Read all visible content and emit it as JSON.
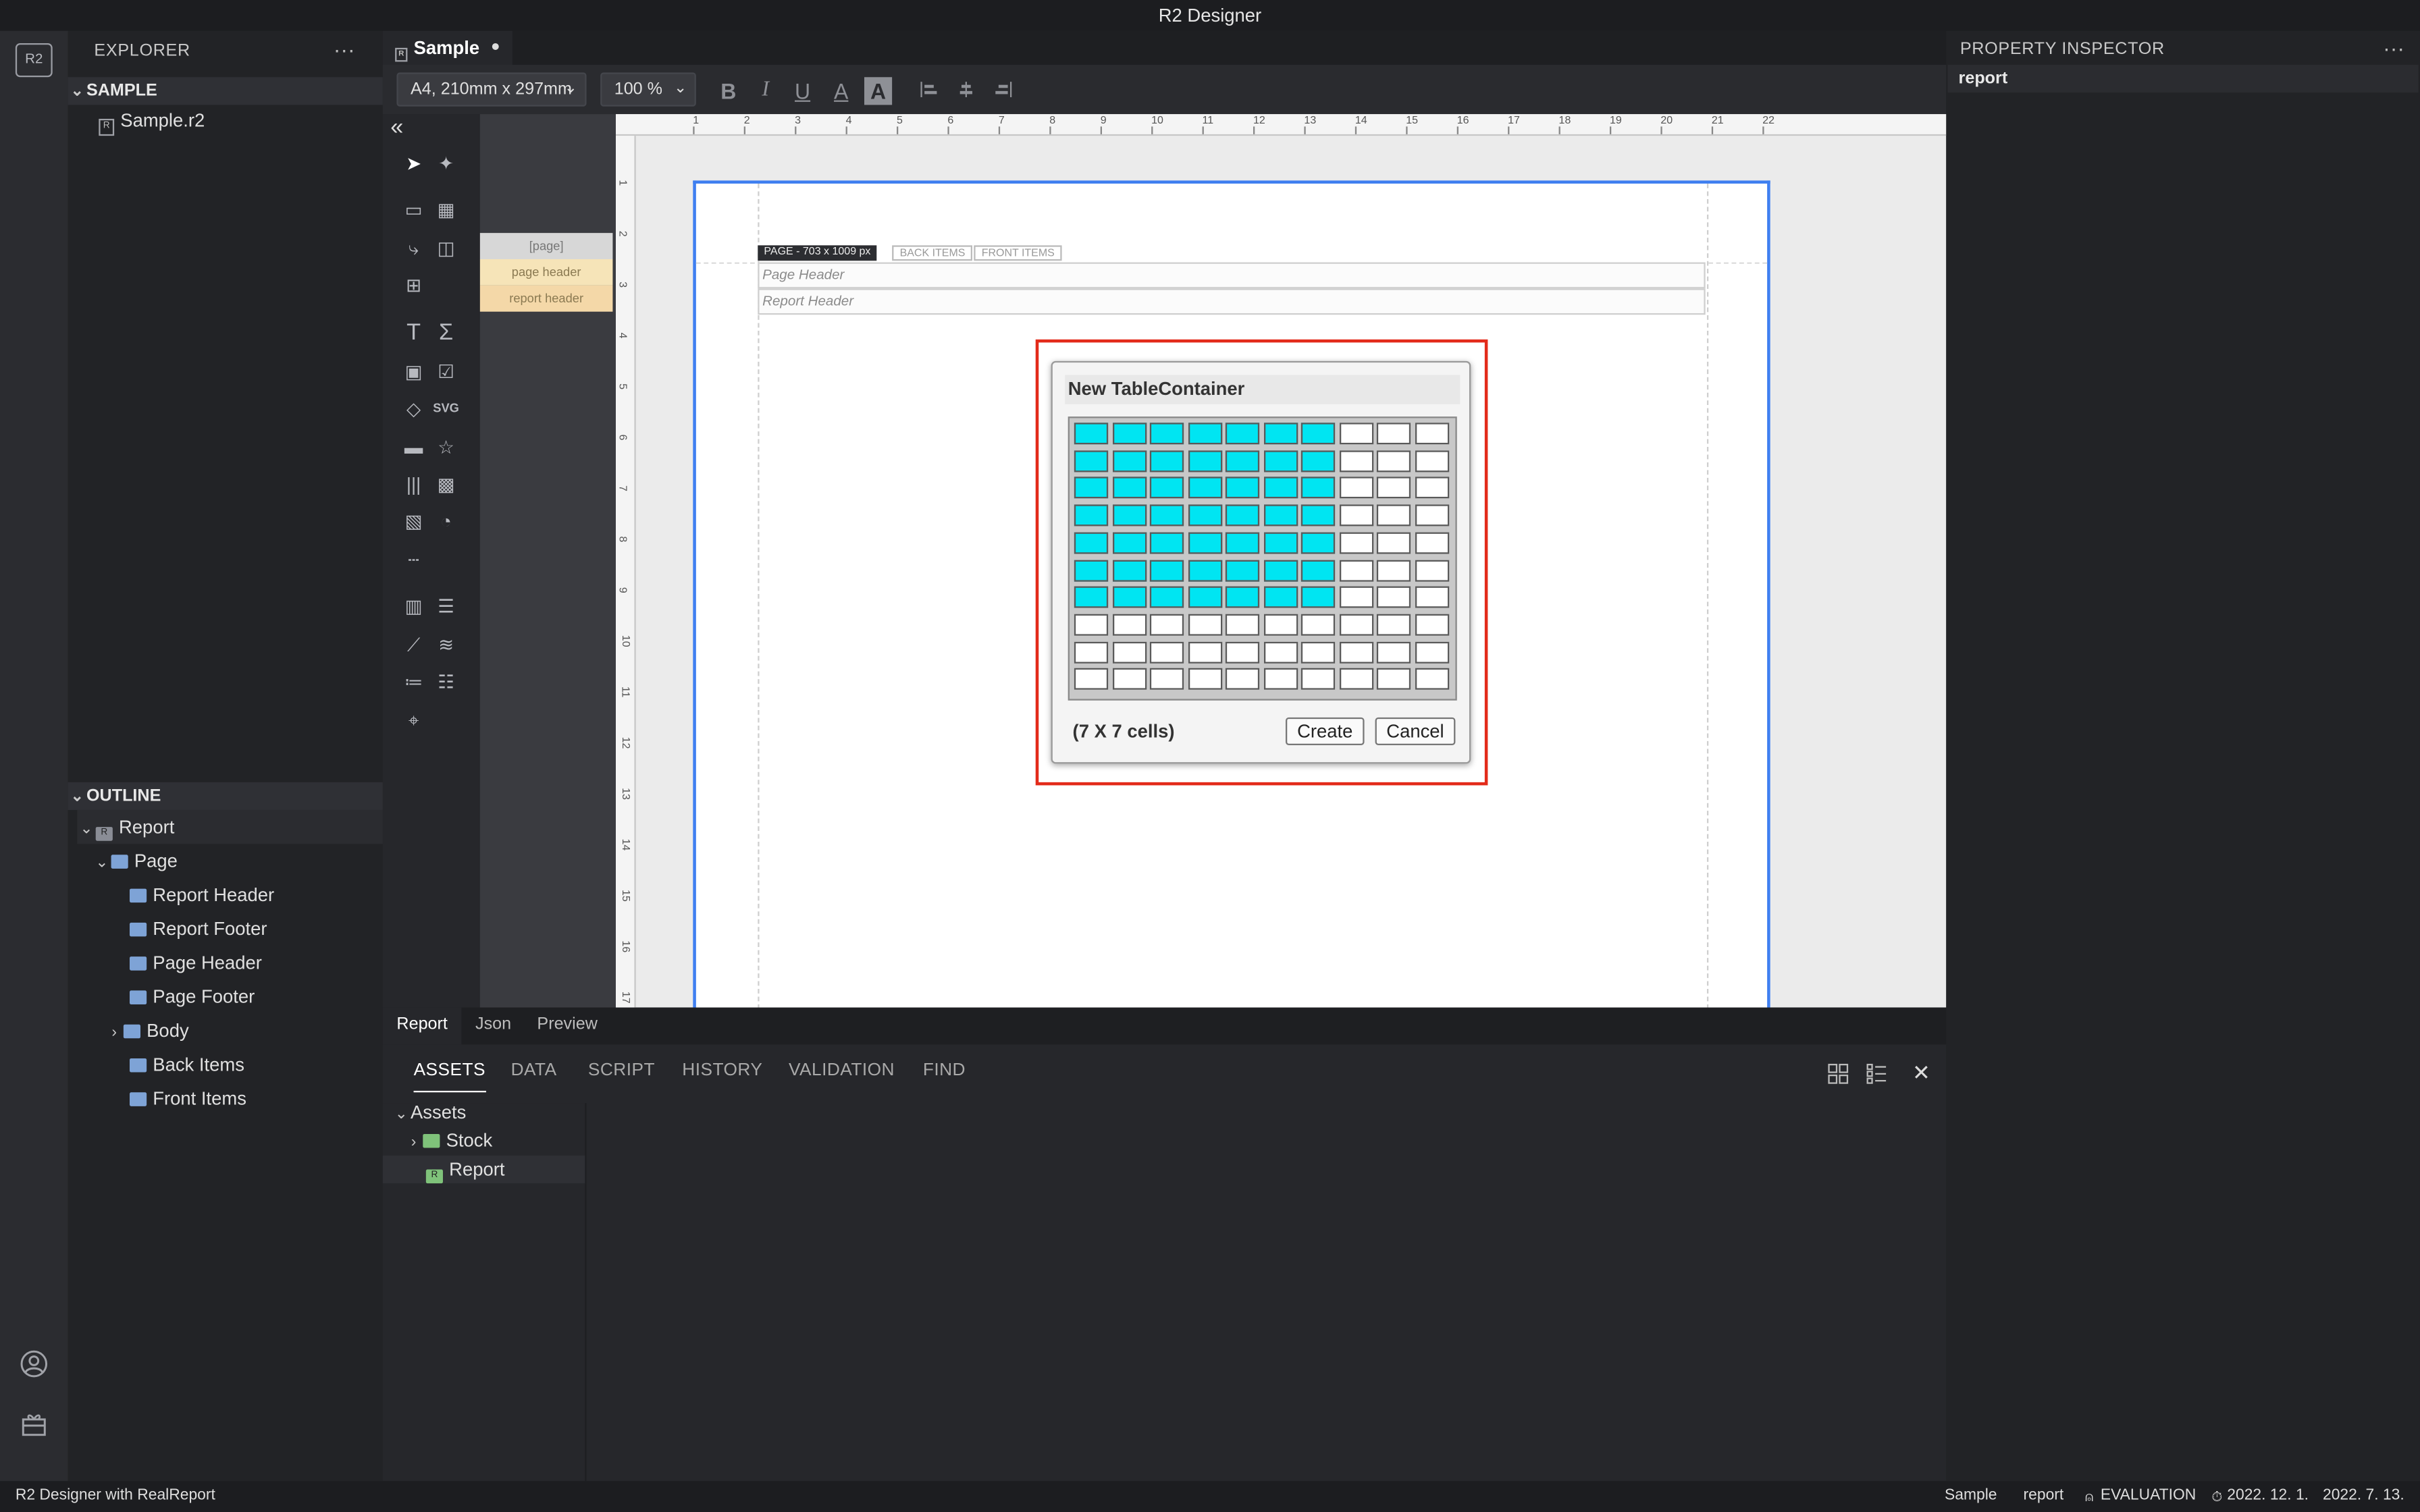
{
  "app": {
    "title": "R2 Designer",
    "logo": "R2"
  },
  "explorer": {
    "title": "EXPLORER",
    "more": "···",
    "section": "SAMPLE",
    "file": "Sample.r2"
  },
  "outline": {
    "title": "OUTLINE",
    "report": "Report",
    "page": "Page",
    "items": [
      "Report Header",
      "Report Footer",
      "Page Header",
      "Page Footer",
      "Body",
      "Back Items",
      "Front Items"
    ]
  },
  "editor": {
    "tab": "Sample",
    "paper": "A4, 210mm x 297mm",
    "zoom": "100 %",
    "format_buttons": [
      "B",
      "I",
      "U",
      "A",
      "A"
    ],
    "ruler_h": [
      "1",
      "2",
      "3",
      "4",
      "5",
      "6",
      "7",
      "8",
      "9",
      "10",
      "11",
      "12",
      "13",
      "14",
      "15",
      "16",
      "17",
      "18",
      "19",
      "20",
      "21",
      "22"
    ],
    "ruler_v": [
      "1",
      "2",
      "3",
      "4",
      "5",
      "6",
      "7",
      "8",
      "9",
      "10",
      "11",
      "12",
      "13",
      "14",
      "15",
      "16",
      "17"
    ],
    "bands": [
      "[page]",
      "page header",
      "report header"
    ],
    "page_badges": [
      "PAGE - 703 x 1009 px",
      "BACK ITEMS",
      "FRONT ITEMS"
    ],
    "page_header": "Page Header",
    "report_header": "Report Header",
    "tools": {
      "svg_label": "SVG"
    }
  },
  "dialog": {
    "title": "New TableContainer",
    "grid": {
      "rows": 10,
      "cols": 10,
      "selected_rows": 7,
      "selected_cols": 7
    },
    "info": "(7 X 7 cells)",
    "create": "Create",
    "cancel": "Cancel"
  },
  "view_tabs": [
    "Report",
    "Json",
    "Preview"
  ],
  "bottom_panel": {
    "tabs": [
      "ASSETS",
      "DATA",
      "SCRIPT",
      "HISTORY",
      "VALIDATION",
      "FIND"
    ],
    "assets_root": "Assets",
    "stock": "Stock",
    "report": "Report",
    "close": "✕"
  },
  "inspector": {
    "title": "PROPERTY INSPECTOR",
    "more": "···",
    "selected": "report"
  },
  "status": {
    "left": "R2 Designer with RealReport",
    "doc": "Sample",
    "item": "report",
    "license": "EVALUATION",
    "date1": "2022. 12. 1.",
    "date2": "2022. 7. 13."
  },
  "colors": {
    "selection": "#00e5f2",
    "highlight": "#e32b1a",
    "page_border": "#3f7ff0"
  }
}
